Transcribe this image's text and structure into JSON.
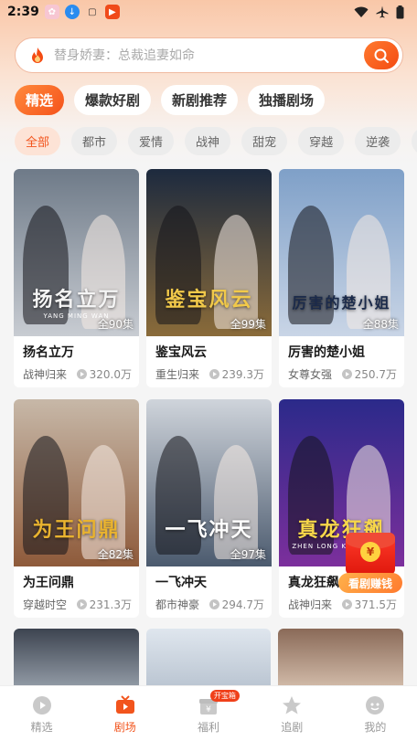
{
  "status_bar": {
    "time": "2:39",
    "icons": [
      "app-icon-pink",
      "download-icon",
      "box-icon",
      "video-app-icon"
    ],
    "right_icons": [
      "wifi-icon",
      "airplane-icon",
      "battery-icon"
    ]
  },
  "search": {
    "placeholder": "替身娇妻：总裁追妻如命",
    "icon": "flame-icon",
    "button_icon": "search-icon"
  },
  "main_tabs": [
    {
      "label": "精选",
      "active": true
    },
    {
      "label": "爆款好剧",
      "active": false
    },
    {
      "label": "新剧推荐",
      "active": false
    },
    {
      "label": "独播剧场",
      "active": false
    }
  ],
  "genres": [
    {
      "label": "全部",
      "active": true
    },
    {
      "label": "都市"
    },
    {
      "label": "爱情"
    },
    {
      "label": "战神"
    },
    {
      "label": "甜宠"
    },
    {
      "label": "穿越"
    },
    {
      "label": "逆袭"
    },
    {
      "label": "霸"
    }
  ],
  "dramas": [
    {
      "title": "扬名立万",
      "tag": "战神归来",
      "views": "320.0万",
      "episodes": "全90集",
      "art_title": "扬名立万",
      "art_sub": "YANG  MING  WAN",
      "palette": [
        "#6e7a88",
        "#c8ccd2"
      ],
      "art_color": "#f4f4f4"
    },
    {
      "title": "鉴宝风云",
      "tag": "重生归来",
      "views": "239.3万",
      "episodes": "全99集",
      "art_title": "鉴宝风云",
      "art_sub": "",
      "palette": [
        "#1d2a3e",
        "#8a6b3a"
      ],
      "art_color": "#f1c94a"
    },
    {
      "title": "厉害的楚小姐",
      "tag": "女尊女强",
      "views": "250.7万",
      "episodes": "全88集",
      "art_title": "厉害的楚小姐",
      "art_sub": "",
      "palette": [
        "#7fa0c8",
        "#c9d5e6"
      ],
      "art_color": "#1b2a4a"
    },
    {
      "title": "为王问鼎",
      "tag": "穿越时空",
      "views": "231.3万",
      "episodes": "全82集",
      "art_title": "为王问鼎",
      "art_sub": "",
      "palette": [
        "#c7b8a8",
        "#8e5a3a"
      ],
      "art_color": "#e9b32f"
    },
    {
      "title": "一飞冲天",
      "tag": "都市神豪",
      "views": "294.7万",
      "episodes": "全97集",
      "art_title": "一飞冲天",
      "art_sub": "",
      "palette": [
        "#cfd4db",
        "#4b5a6e"
      ],
      "art_color": "#ffffff"
    },
    {
      "title": "真龙狂飙",
      "tag": "战神归来",
      "views": "371.5万",
      "episodes": "",
      "art_title": "真龙狂飙",
      "art_sub": "ZHEN LONG KUANG BIAO",
      "palette": [
        "#2b2a8a",
        "#7c2f9c"
      ],
      "art_color": "#f7d74a"
    }
  ],
  "partial_row": [
    {
      "palette": [
        "#3d4450",
        "#9aa3ae"
      ]
    },
    {
      "palette": [
        "#dfe6ee",
        "#b7c2cf"
      ]
    },
    {
      "palette": [
        "#8a6a58",
        "#d8c2b0"
      ]
    }
  ],
  "float_button": {
    "label": "看剧赚钱",
    "coin": "¥"
  },
  "bottom_nav": [
    {
      "label": "精选",
      "icon": "play-circle-icon",
      "active": false
    },
    {
      "label": "剧场",
      "icon": "tv-icon",
      "active": true
    },
    {
      "label": "福利",
      "icon": "gift-icon",
      "active": false,
      "badge": "开宝箱"
    },
    {
      "label": "追剧",
      "icon": "star-icon",
      "active": false
    },
    {
      "label": "我的",
      "icon": "profile-icon",
      "active": false
    }
  ],
  "colors": {
    "accent": "#f2541c",
    "accent_light": "#fde3d6"
  }
}
